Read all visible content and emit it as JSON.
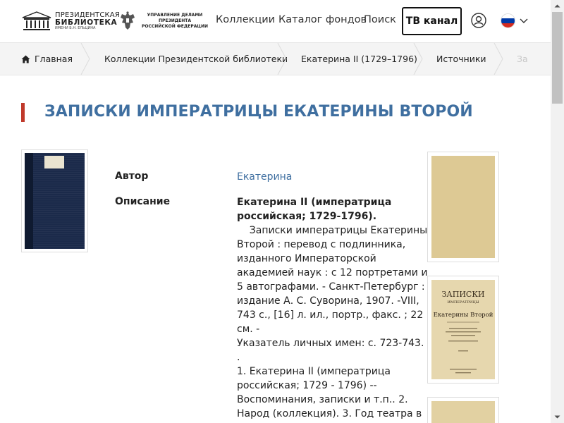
{
  "header": {
    "logo_library": {
      "line1": "ПРЕЗИДЕНТСКАЯ",
      "line2": "БИБЛИОТЕКА",
      "line3": "ИМЕНИ Б.Н. ЕЛЬЦИНА"
    },
    "logo_ud": {
      "line1": "УПРАВЛЕНИЕ ДЕЛАМИ ПРЕЗИДЕНТА",
      "line2": "РОССИЙСКОЙ ФЕДЕРАЦИИ"
    },
    "nav": [
      "Коллекции",
      "Каталог фондов",
      "Поиск"
    ],
    "tv_button": "ТВ канал",
    "user_icon": "user-circle-icon",
    "language_icon": "russia-flag-icon"
  },
  "breadcrumb": [
    "Главная",
    "Коллекции Президентской библиотеки",
    "Екатерина II (1729–1796)",
    "Источники",
    "За"
  ],
  "title": "ЗАПИСКИ ИМПЕРАТРИЦЫ ЕКАТЕРИНЫ ВТОРОЙ",
  "meta": {
    "author_label": "Автор",
    "author_value": "Екатерина",
    "description_label": "Описание",
    "description_bold": [
      "Екатерина II (императрица",
      "российская; 1729-1796)."
    ],
    "description_lines": [
      "    Записки императрицы Екатерины",
      "Второй : перевод с подлинника,",
      "изданного Императорской",
      "академией наук : с 12 портретами и",
      "5 автографами. - Санкт-Петербург :",
      "издание А. С. Суворина, 1907. -VIII,",
      "743 с., [16] л. ил., портр., факс. ; 22",
      "см. -",
      "Указатель личных имен: с. 723-743.",
      ".",
      "1. Екатерина II (императрица",
      "российская; 1729 - 1796) --",
      "Воспоминания, записки и т.п.. 2.",
      "Народ (коллекция). 3. Год театра в"
    ]
  },
  "thumbnails": {
    "page2_title_top": "ЗАПИСКИ",
    "page2_title_mid": "ИМПЕРАТРИЦЫ",
    "page2_title_main": "Екатерины Второй"
  },
  "colors": {
    "title": "#3f6fa0",
    "accent_bar": "#c0392b",
    "link": "#3f6fa0",
    "breadcrumb_bg": "#f4f4f4"
  }
}
